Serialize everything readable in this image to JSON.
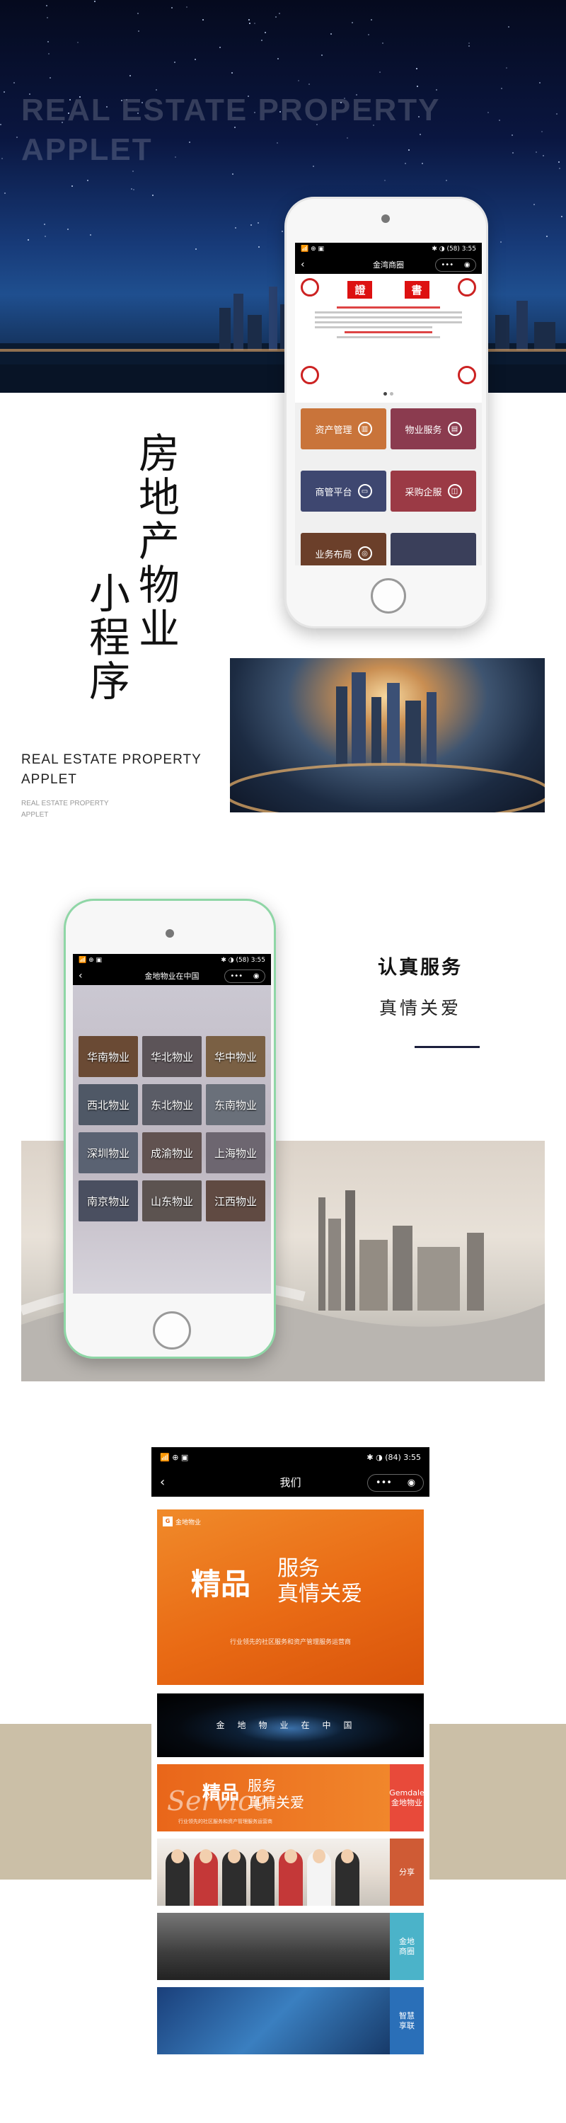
{
  "hero": {
    "title": "REAL ESTATE PROPERTY APPLET"
  },
  "status_bar": {
    "left": "📶 ⊕ ▣",
    "right": "✱ ◑ (58) 3:55"
  },
  "phone1": {
    "nav_title": "金湾商圈",
    "certificate": {
      "stamp_left": "證",
      "stamp_right": "書"
    },
    "tiles": [
      {
        "label": "资产管理",
        "color": "#c9743a"
      },
      {
        "label": "物业服务",
        "color": "#8b3b4f"
      },
      {
        "label": "商管平台",
        "color": "#3e4770"
      },
      {
        "label": "采购企服",
        "color": "#9b3a45"
      },
      {
        "label": "业务布局",
        "color": "#6b3f2a"
      },
      {
        "label": "",
        "color": "#3a3f5a"
      }
    ]
  },
  "vertical_title": {
    "col1": "房地产物业",
    "col2": "小程序"
  },
  "caption": {
    "en_main": "REAL ESTATE PROPERTY APPLET",
    "en_small": "REAL ESTATE PROPERTY APPLET"
  },
  "section2": {
    "title": "认真服务",
    "subtitle": "真情关爱"
  },
  "phone2": {
    "nav_title": "金地物业在中国",
    "regions": [
      "华南物业",
      "华北物业",
      "华中物业",
      "西北物业",
      "东北物业",
      "东南物业",
      "深圳物业",
      "成渝物业",
      "上海物业",
      "南京物业",
      "山东物业",
      "江西物业"
    ]
  },
  "phone3": {
    "nav_title": "我们",
    "status_right": "✱ ◑ (84) 3:55",
    "banner1": {
      "brand": "金地物业",
      "big": "精品",
      "small_1": "服务",
      "small_2": "真情关爱",
      "caption": "行业领先的社区服务和资产管理服务运营商"
    },
    "banner2": {
      "text": "金地物业在中国"
    },
    "banner3": {
      "service": "Service",
      "big": "精品",
      "small_1": "服务",
      "small_2": "真情关爱",
      "caption": "行业领先的社区服务和资产管理服务运营商",
      "tab": "Gemdale 金地物业"
    },
    "banner4": {
      "tab": "分享"
    },
    "banner5": {
      "tab_1": "金地",
      "tab_2": "商圈"
    },
    "banner6": {
      "tab_1": "智慧",
      "tab_2": "享联"
    }
  },
  "colors": {
    "accent_orange": "#e96a14",
    "navy_line": "#1b1f3c",
    "beige_band": "#cbbfa7"
  }
}
